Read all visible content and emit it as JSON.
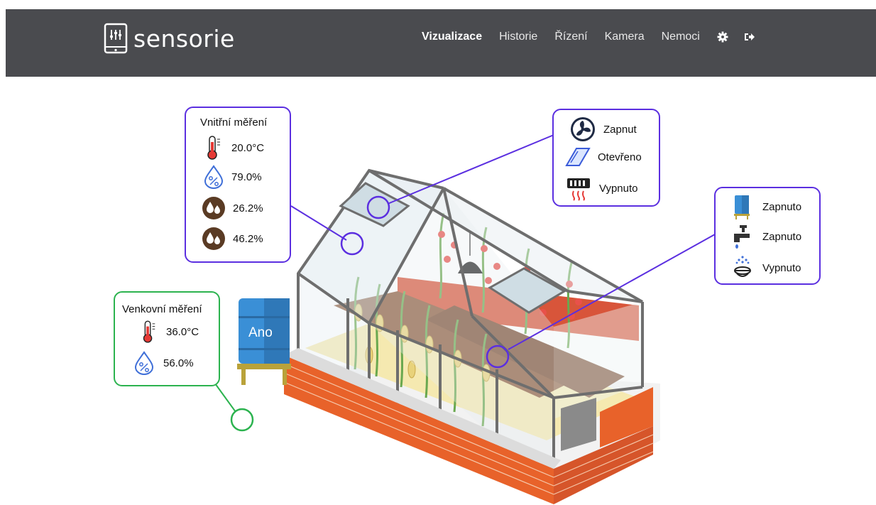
{
  "brand": {
    "name": "sensorie"
  },
  "nav": {
    "items": [
      "Vizualizace",
      "Historie",
      "Řízení",
      "Kamera",
      "Nemoci"
    ],
    "active": "Vizualizace",
    "icons": [
      "gear-icon",
      "logout-icon"
    ]
  },
  "inside": {
    "title": "Vnitřní měření",
    "temperature": "20.0°C",
    "air_humidity": "79.0%",
    "soil_moisture_1": "26.2%",
    "soil_moisture_2": "46.2%"
  },
  "outside": {
    "title": "Venkovní měření",
    "temperature": "36.0°C",
    "humidity": "56.0%"
  },
  "climate": {
    "fan": "Zapnut",
    "window": "Otevřeno",
    "heating": "Vypnuto"
  },
  "water": {
    "tank": "Zapnuto",
    "tap": "Zapnuto",
    "sprinkler": "Vypnuto"
  },
  "barrel": {
    "label": "Ano"
  },
  "colors": {
    "header_bg": "#4a4b4f",
    "callout_purple": "#5b2fe0",
    "callout_green": "#2cb34f",
    "brick": "#e8622a",
    "barrel_blue": "#3a8fd6"
  }
}
